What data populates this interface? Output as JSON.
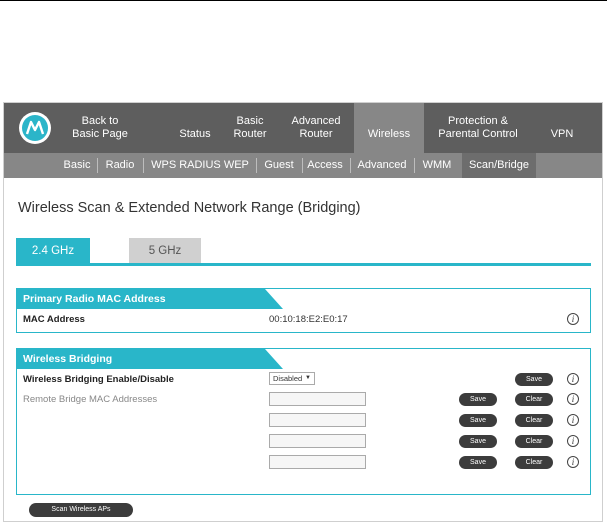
{
  "nav": {
    "items": [
      {
        "label": "Back to\nBasic Page"
      },
      {
        "label": "Status"
      },
      {
        "label": "Basic\nRouter"
      },
      {
        "label": "Advanced\nRouter"
      },
      {
        "label": "Wireless"
      },
      {
        "label": "Protection &\nParental Control"
      },
      {
        "label": "VPN"
      }
    ],
    "active": "Wireless"
  },
  "subnav": {
    "items": [
      "Basic",
      "Radio",
      "WPS RADIUS WEP",
      "Guest",
      "Access",
      "Advanced",
      "WMM",
      "Scan/Bridge"
    ],
    "active": "Scan/Bridge"
  },
  "page": {
    "title": "Wireless Scan & Extended Network Range (Bridging)"
  },
  "tabs": {
    "band_24": "2.4 GHz",
    "band_5": "5 GHz",
    "active": "2.4 GHz"
  },
  "primary_radio": {
    "title": "Primary Radio MAC Address",
    "mac_label": "MAC Address",
    "mac_value": "00:10:18:E2:E0:17"
  },
  "bridging": {
    "title": "Wireless Bridging",
    "enable_label": "Wireless Bridging Enable/Disable",
    "enable_value": "Disabled",
    "remote_label": "Remote Bridge MAC Addresses",
    "save_label": "Save",
    "clear_label": "Clear",
    "remote_rows": 4
  },
  "scan_button_label": "Scan Wireless APs",
  "info_glyph": "i",
  "colors": {
    "accent": "#29b6c9",
    "nav_bg": "#5e5e5e",
    "subnav_bg": "#878787",
    "button_bg": "#3c3c3c"
  }
}
